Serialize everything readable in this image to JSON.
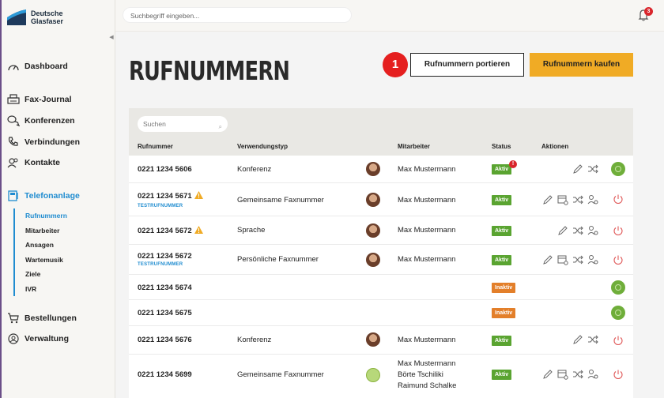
{
  "app": {
    "brand_line1": "Deutsche",
    "brand_line2": "Glasfaser"
  },
  "topbar": {
    "search_placeholder": "Suchbegriff eingeben...",
    "notification_count": "3"
  },
  "sidebar": {
    "items": [
      {
        "label": "Dashboard",
        "icon": "speedometer-icon"
      },
      {
        "label": "Fax-Journal",
        "icon": "fax-icon"
      },
      {
        "label": "Konferenzen",
        "icon": "chat-icon"
      },
      {
        "label": "Verbindungen",
        "icon": "phone-icon"
      },
      {
        "label": "Kontakte",
        "icon": "contacts-icon"
      },
      {
        "label": "Telefonanlage",
        "icon": "phone-system-icon"
      },
      {
        "label": "Bestellungen",
        "icon": "cart-icon"
      },
      {
        "label": "Verwaltung",
        "icon": "user-circle-icon"
      }
    ],
    "subitems": [
      "Rufnummern",
      "Mitarbeiter",
      "Ansagen",
      "Wartemusik",
      "Ziele",
      "IVR"
    ]
  },
  "page": {
    "title": "RUFNUMMERN",
    "step_badge": "1",
    "port_button": "Rufnummern portieren",
    "buy_button": "Rufnummern kaufen",
    "table_search_placeholder": "Suchen"
  },
  "table": {
    "headers": [
      "Rufnummer",
      "Verwendungstyp",
      "Mitarbeiter",
      "Status",
      "Aktionen"
    ],
    "rows": [
      {
        "number": "0221 1234 5606",
        "tag": "",
        "type": "Konferenz",
        "staff": [
          "Max Mustermann"
        ],
        "status": "Aktiv"
      },
      {
        "number": "0221 1234 5671",
        "tag": "TESTRUFNUMMER",
        "type": "Gemeinsame Faxnummer",
        "staff": [
          "Max Mustermann"
        ],
        "status": "Aktiv"
      },
      {
        "number": "0221 1234 5672",
        "tag": "",
        "type": "Sprache",
        "staff": [
          "Max Mustermann"
        ],
        "status": "Aktiv"
      },
      {
        "number": "0221 1234 5672",
        "tag": "TESTRUFNUMMER",
        "type": "Persönliche Faxnummer",
        "staff": [
          "Max Mustermann"
        ],
        "status": "Aktiv"
      },
      {
        "number": "0221 1234 5674",
        "tag": "",
        "type": "",
        "staff": [],
        "status": "Inaktiv"
      },
      {
        "number": "0221 1234 5675",
        "tag": "",
        "type": "",
        "staff": [],
        "status": "Inaktiv"
      },
      {
        "number": "0221 1234 5676",
        "tag": "",
        "type": "Konferenz",
        "staff": [
          "Max Mustermann"
        ],
        "status": "Aktiv"
      },
      {
        "number": "0221 1234 5699",
        "tag": "",
        "type": "Gemeinsame Faxnummer",
        "staff": [
          "Max Mustermann",
          "Börte Tschiliki",
          "Raimund Schalke"
        ],
        "status": "Aktiv"
      }
    ]
  },
  "colors": {
    "accent_blue": "#1f8cd0",
    "buy_orange": "#f0ab25",
    "status_active": "#5aa431",
    "status_inactive": "#e37f2a",
    "alert_red": "#d9262c"
  }
}
